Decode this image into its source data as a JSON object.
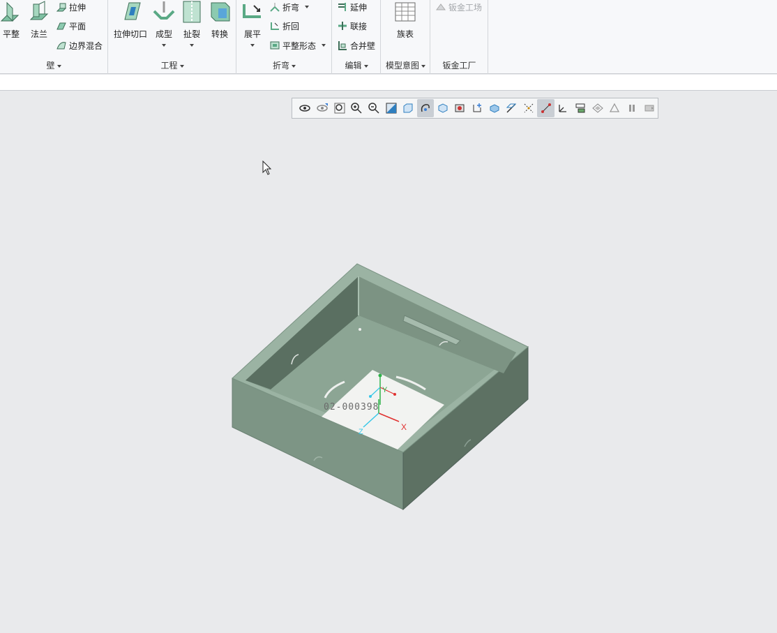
{
  "ribbon": {
    "wall_group": {
      "label": "壁",
      "flat": "平整",
      "flange": "法兰",
      "extrude": "拉伸",
      "planar": "平面",
      "boundary_blend": "边界混合"
    },
    "engineering_group": {
      "label": "工程",
      "extrude_cut": "拉伸切口",
      "form": "成型",
      "rip": "扯裂",
      "convert": "转换"
    },
    "bend_group": {
      "label": "折弯",
      "unbend": "展平",
      "bend": "折弯",
      "bend_back": "折回",
      "flat_state": "平整形态"
    },
    "edit_group": {
      "label": "编辑",
      "extend": "延伸",
      "join": "联接",
      "merge_walls": "合并壁"
    },
    "model_intent_group": {
      "label": "模型意图",
      "family_table": "族表"
    },
    "sheetmetal_factory_group": {
      "label": "钣金工厂",
      "sheetmetal_workshop": "钣金工场"
    }
  },
  "graphics_toolbar": {
    "items": [
      "saved-orientation",
      "view-manager",
      "refit",
      "zoom-in",
      "zoom-out",
      "repaint",
      "display-style",
      "spin-center",
      "saved-views",
      "appearance",
      "annotation-display",
      "section",
      "datum-planes",
      "datum-axes",
      "datum-points",
      "coordinate-systems",
      "model-tree-display",
      "layers",
      "simplified-rep",
      "pause",
      "next"
    ],
    "active": [
      "spin-center",
      "coordinate-systems"
    ]
  },
  "model": {
    "label_text": "02-000398",
    "csys_labels": {
      "x": "X",
      "y": "Y",
      "z": "Z"
    },
    "colors": {
      "top": "#93ab9b",
      "left": "#7d9585",
      "right": "#5d7163",
      "inner": "#8aa292",
      "label_bg": "#f2f3f1"
    }
  }
}
